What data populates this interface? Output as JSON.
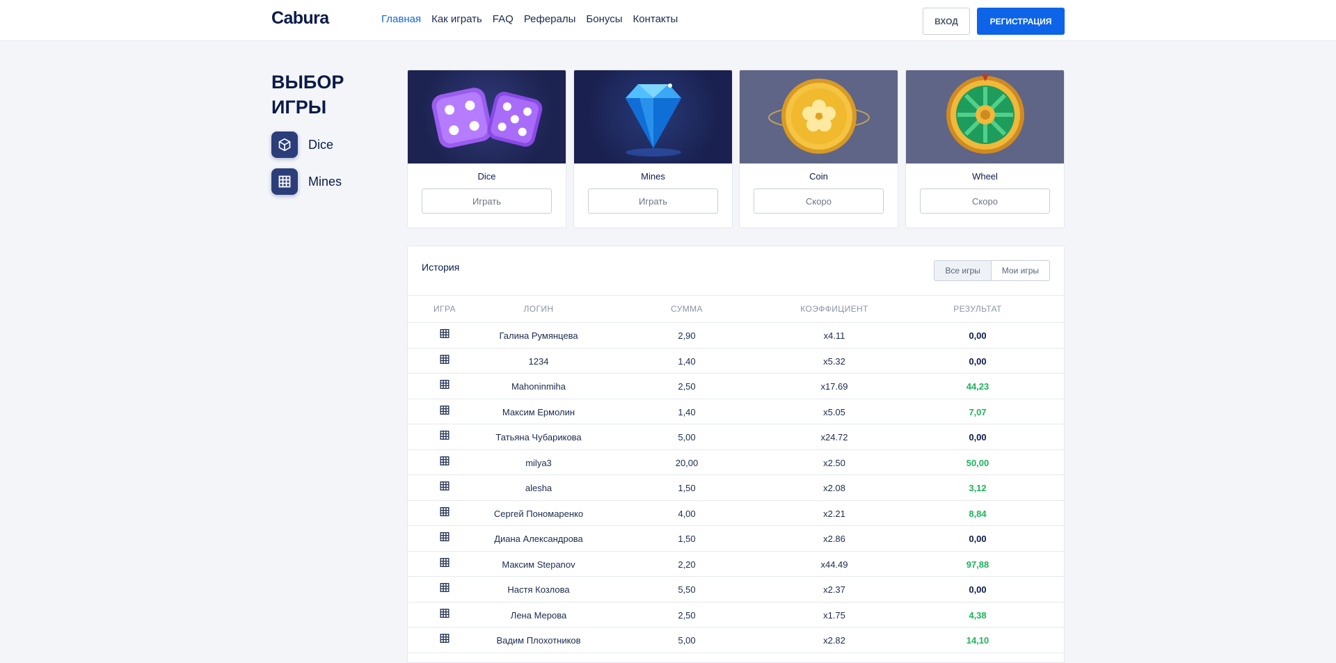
{
  "header": {
    "logo": "Cabura",
    "nav": [
      "Главная",
      "Как играть",
      "FAQ",
      "Рефералы",
      "Бонусы",
      "Контакты"
    ],
    "active_nav": "Главная",
    "login": "ВХОД",
    "register": "РЕГИСТРАЦИЯ"
  },
  "sidebar": {
    "title": "ВЫБОР ИГРЫ",
    "items": [
      {
        "label": "Dice",
        "icon": "cube-icon"
      },
      {
        "label": "Mines",
        "icon": "grid-icon"
      }
    ]
  },
  "games": [
    {
      "name": "Dice",
      "button": "Играть",
      "image": "dice-image"
    },
    {
      "name": "Mines",
      "button": "Играть",
      "image": "diamond-image"
    },
    {
      "name": "Coin",
      "button": "Скоро",
      "image": "coin-image"
    },
    {
      "name": "Wheel",
      "button": "Скоро",
      "image": "wheel-image"
    }
  ],
  "history": {
    "title": "История",
    "filters": [
      "Все игры",
      "Мои игры"
    ],
    "columns": [
      "ИГРА",
      "ЛОГИН",
      "СУММА",
      "КОЭФФИЦИЕНТ",
      "РЕЗУЛЬТАТ"
    ],
    "rows": [
      {
        "game": "grid-icon",
        "login": "Галина Румянцева",
        "sum": "2,90",
        "coef": "x4.11",
        "result": "0,00",
        "win": false
      },
      {
        "game": "grid-icon",
        "login": "1234",
        "sum": "1,40",
        "coef": "x5.32",
        "result": "0,00",
        "win": false
      },
      {
        "game": "grid-icon",
        "login": "Mahoninmiha",
        "sum": "2,50",
        "coef": "x17.69",
        "result": "44,23",
        "win": true
      },
      {
        "game": "grid-icon",
        "login": "Максим Ермолин",
        "sum": "1,40",
        "coef": "x5.05",
        "result": "7,07",
        "win": true
      },
      {
        "game": "grid-icon",
        "login": "Татьяна Чубарикова",
        "sum": "5,00",
        "coef": "x24.72",
        "result": "0,00",
        "win": false
      },
      {
        "game": "grid-icon",
        "login": "milya3",
        "sum": "20,00",
        "coef": "x2.50",
        "result": "50,00",
        "win": true
      },
      {
        "game": "grid-icon",
        "login": "alesha",
        "sum": "1,50",
        "coef": "x2.08",
        "result": "3,12",
        "win": true
      },
      {
        "game": "grid-icon",
        "login": "Сергей Пономаренко",
        "sum": "4,00",
        "coef": "x2.21",
        "result": "8,84",
        "win": true
      },
      {
        "game": "grid-icon",
        "login": "Диана Александрова",
        "sum": "1,50",
        "coef": "x2.86",
        "result": "0,00",
        "win": false
      },
      {
        "game": "grid-icon",
        "login": "Максим Stepanov",
        "sum": "2,20",
        "coef": "x44.49",
        "result": "97,88",
        "win": true
      },
      {
        "game": "grid-icon",
        "login": "Настя Козлова",
        "sum": "5,50",
        "coef": "x2.37",
        "result": "0,00",
        "win": false
      },
      {
        "game": "grid-icon",
        "login": "Лена Мерова",
        "sum": "2,50",
        "coef": "x1.75",
        "result": "4,38",
        "win": true
      },
      {
        "game": "grid-icon",
        "login": "Вадим Плохотников",
        "sum": "5,00",
        "coef": "x2.82",
        "result": "14,10",
        "win": true
      }
    ]
  },
  "colors": {
    "accent": "#0d64e8",
    "win": "#1cb45a",
    "dark": "#0b1a4a"
  }
}
